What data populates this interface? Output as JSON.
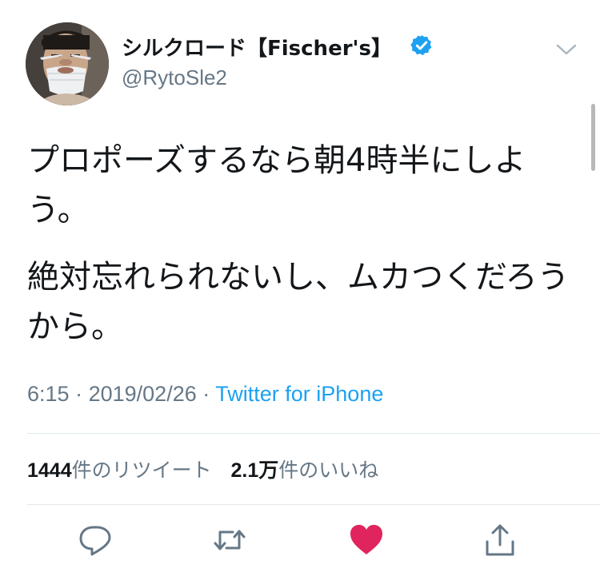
{
  "user": {
    "display_name": "シルクロード【Fischer's】",
    "handle": "@RytoSle2",
    "verified": true,
    "avatar_icon": "user-avatar"
  },
  "tweet": {
    "paragraphs": [
      "プロポーズするなら朝4時半にしよう。",
      "絶対忘れられないし、ムカつくだろうから。"
    ],
    "time": "6:15",
    "separator": "·",
    "date": "2019/02/26",
    "source": "Twitter for iPhone"
  },
  "stats": {
    "retweet_count": "1444",
    "retweet_label": "件のリツイート",
    "like_count": "2.1万",
    "like_label": "件のいいね"
  },
  "actions": {
    "reply_icon": "reply-icon",
    "retweet_icon": "retweet-icon",
    "like_icon": "heart-icon",
    "share_icon": "share-icon"
  },
  "colors": {
    "accent": "#1da1f2",
    "like": "#e0245e",
    "muted": "#657786",
    "text": "#14171a",
    "divider": "#e1e8ed"
  }
}
